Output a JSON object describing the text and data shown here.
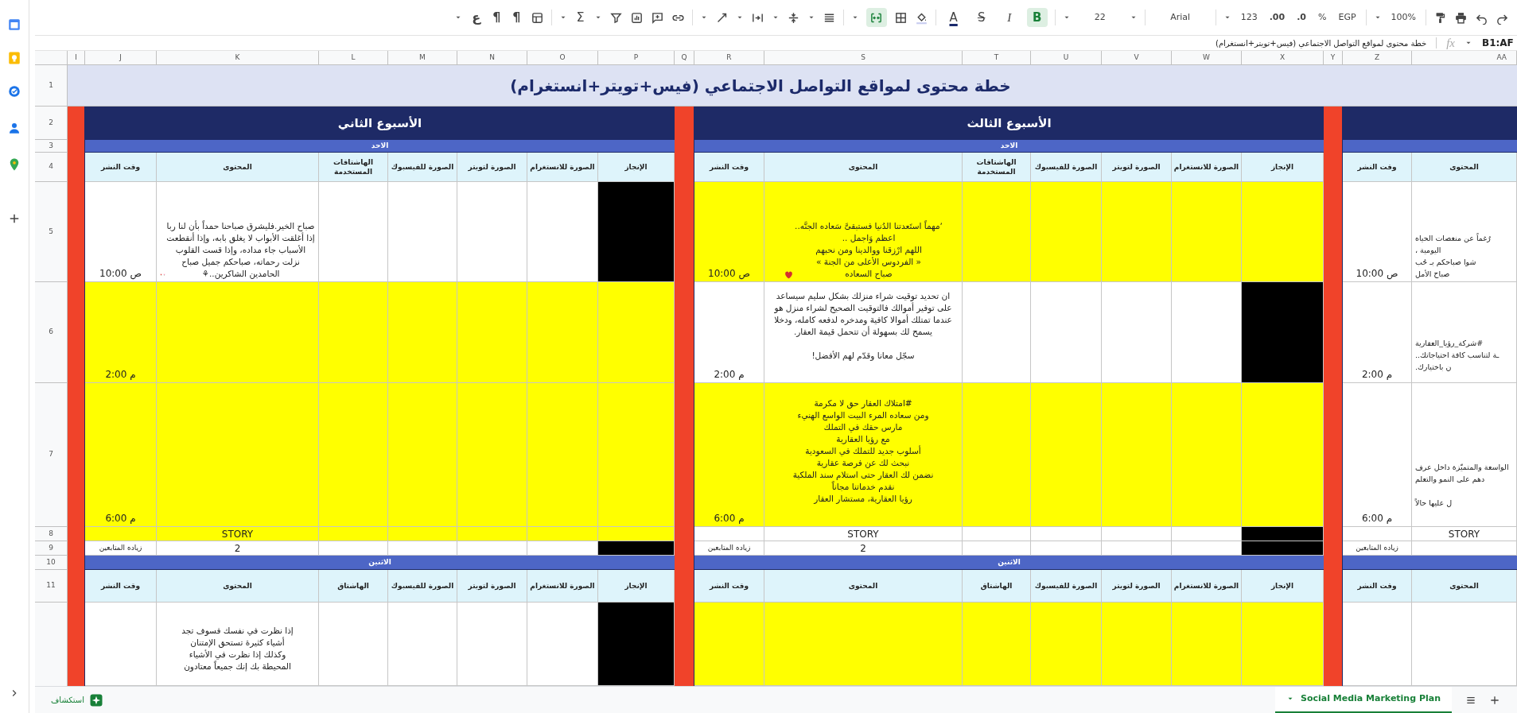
{
  "toolbar": {
    "direction": "ع",
    "para_rtl": "¶",
    "para_ltr": "¶",
    "sum": "Σ",
    "merge_cells": {
      "on": true
    },
    "format_buttons": [
      {
        "label": "B",
        "on": true
      },
      {
        "label": "I",
        "on": false
      },
      {
        "label": "S",
        "on": false
      },
      {
        "label": "A",
        "on": false
      }
    ],
    "font_size": "22",
    "font": "Arial",
    "number_format": "123",
    "decimals_add": ".00",
    "decimals_remove": ".0",
    "percent": "%",
    "currency": "EGP",
    "zoom": "100%"
  },
  "formula_bar": {
    "formula": "خطة محتوى لمواقع التواصل الاجتماعي (فيس+تويتر+انستغرام)",
    "fx": "fx",
    "name_box": "B1:AF"
  },
  "columns": [
    "AA",
    "Z",
    "Y",
    "X",
    "W",
    "V",
    "U",
    "T",
    "S",
    "R",
    "Q",
    "P",
    "O",
    "N",
    "M",
    "L",
    "K",
    "J",
    "I"
  ],
  "row_numbers": [
    "1",
    "2",
    "3",
    "4",
    "5",
    "6",
    "7",
    "8",
    "9",
    "10",
    "11"
  ],
  "title": "خطة محتوى لمواقع التواصل الاجتماعي (فيس+تويتر+انستغرام)",
  "weeks": [
    {
      "days": [
        {
          "headers": [
            "المحتوى",
            "وقت النشر"
          ],
          "slots": [
            {
              "time": "10:00 ص",
              "content": "رُغماً عن منغصات الحياه\nاليومية ،\nشوا صباحكم بـ حُب\nصباح الأمل",
              "highlighted": false
            },
            {
              "time": "2:00 م",
              "content": "#شركة_رؤيا_العقارية\nـة لتناسب كافة احتياجاتك..\nن باختيارك.",
              "highlighted": false
            },
            {
              "time": "6:00 م",
              "content": "الواسعة والمتميّزة داخل عرف\nدهم على النمو والتعلم\n\nل عليها حالاً",
              "highlighted": false
            }
          ],
          "story": {
            "label": "STORY",
            "highlighted": false
          },
          "followers": {
            "label": "زياده المتابعين"
          }
        },
        {
          "headers": [
            "المحتوى",
            "وقت النشر"
          ],
          "slots": [
            {
              "highlighted": false
            }
          ]
        }
      ]
    },
    {
      "title": "الأسبوع الثالث",
      "days": [
        {
          "day": "الاحد",
          "headers": [
            "الإنجاز",
            "الصورة للانستغرام",
            "الصورة لتويتر",
            "الصورة للفيسبوك",
            "الهاشتاقات المستخدمة",
            "المحتوى",
            "وقت النشر"
          ],
          "slots": [
            {
              "time": "10:00 ص",
              "content": "ʼمهماً استَعدتنا الدُنيا فستبقىَّ سَعاده الجنَّه..\nاعظم وَاجمل ..\nاللهم ارْزقنا ووالدينا ومن نحبهم\n« الفردوس الأعلى من الجنة »\nصباح السعاده",
              "highlighted": true,
              "done": false
            },
            {
              "time": "2:00 م",
              "content": "ان تحديد توقيت شراء منزلك بشكل سليم سيساعد على توفير أموالك فالتوقيت الصحيح لشراء منزل هو عندما تمتلك أموالا كافية ومدخره لدفعه كامله، ودخلا يسمح لك بسهولة أن تتحمل قيمة العقار.\n\nسجّل معانا وقدّم لهم الأفضل!",
              "highlighted": false,
              "done": true
            },
            {
              "time": "6:00 م",
              "content": "#امتلاك العقار حق لا مكرمة\nومن سعاده المرء البيت الواسع الهنيء\nمارس حقك في التملك\nمع رؤيا العقارية\nأسلوب جديد للتملك في السعودية\nنبحث لك عن فرصة عقارية\nنضمن لك العقار حتى استلام سند الملكية\nنقدم خدماتنا مجاناً\nرؤيا العقارية، مستشار العقار",
              "highlighted": true,
              "done": false
            }
          ],
          "story": {
            "label": "STORY",
            "highlighted": false,
            "done": true
          },
          "followers": {
            "label": "زياده المتابعين",
            "value": "2",
            "done": true
          }
        },
        {
          "day": "الاثنين",
          "headers": [
            "الإنجاز",
            "الصورة للانستغرام",
            "الصورة لتويتر",
            "الصورة للفيسبوك",
            "الهاشتاق",
            "المحتوى",
            "وقت النشر"
          ],
          "slots": [
            {
              "highlighted": true,
              "done": false
            }
          ]
        }
      ]
    },
    {
      "title": "الأسبوع الثاني",
      "days": [
        {
          "day": "الاحد",
          "headers": [
            "الإنجاز",
            "الصورة للانستغرام",
            "الصورة لتويتر",
            "الصورة للفيسبوك",
            "الهاشتاقات المستخدمة",
            "المحتوى",
            "وقت النشر"
          ],
          "slots": [
            {
              "time": "10:00 ص",
              "content": "صباح الخير.فليشرق صباحنا حمداً بأن لنا ربا إذا أغلقت الأبواب لا يغلق بابه، وإذا أنقطعت الأسباب جاء مداده، وإذا قست القلوب نزلت رحماته، صباحكم جميل صباح الحامدين الشاكرين..⚘",
              "highlighted": false,
              "done": true
            },
            {
              "time": "2:00 م",
              "highlighted": true,
              "done": false
            },
            {
              "time": "6:00 م",
              "highlighted": true,
              "done": false
            }
          ],
          "story": {
            "label": "STORY",
            "highlighted": true,
            "done": false
          },
          "followers": {
            "label": "زياده المتابعين",
            "value": "2",
            "done": true
          }
        },
        {
          "day": "الاثنين",
          "headers": [
            "الإنجاز",
            "الصورة للانستغرام",
            "الصورة لتويتر",
            "الصورة للفيسبوك",
            "الهاشتاق",
            "المحتوى",
            "وقت النشر"
          ],
          "slots": [
            {
              "content": "إذا نظرت في نفسك فسوف تجد\nأشياء كثيرة تستحق الإمتنان\nوكذلك إذا نظرت في الأشياء\nالمحيطة بك إنك جميعاً معتادون",
              "highlighted": false,
              "done": true
            }
          ]
        }
      ]
    }
  ],
  "explore": {
    "label": "استكشاف"
  },
  "sheet_tabs": [
    {
      "label": "Social Media Marketing Plan",
      "selected": true
    }
  ]
}
